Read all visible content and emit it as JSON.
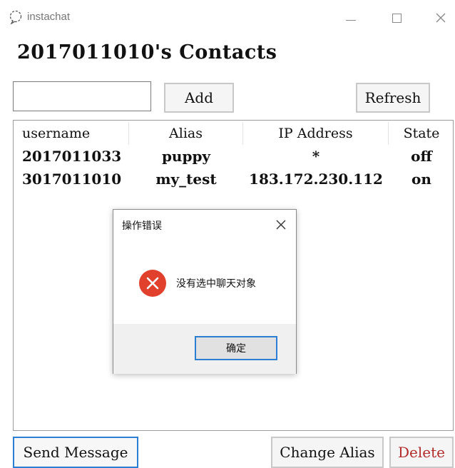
{
  "window": {
    "app_title": "instachat",
    "icons": {
      "app": "chat-bubble-icon",
      "minimize": "minimize-icon",
      "maximize": "maximize-icon",
      "close": "close-icon"
    }
  },
  "header": {
    "title": "2017011010's Contacts"
  },
  "toolbar": {
    "search_value": "",
    "add_label": "Add",
    "refresh_label": "Refresh"
  },
  "table": {
    "columns": [
      "username",
      "Alias",
      "IP Address",
      "State"
    ],
    "rows": [
      {
        "username": "2017011033",
        "alias": "puppy",
        "ip": "*",
        "state": "off"
      },
      {
        "username": "3017011010",
        "alias": "my_test",
        "ip": "183.172.230.112",
        "state": "on"
      }
    ]
  },
  "footer": {
    "send_label": "Send Message",
    "change_alias_label": "Change Alias",
    "delete_label": "Delete"
  },
  "dialog": {
    "title": "操作错误",
    "message": "没有选中聊天对象",
    "ok_label": "确定",
    "icon": "error-icon"
  },
  "colors": {
    "accent_blue": "#2a7fd4",
    "error_red": "#e1402d",
    "delete_red": "#b22b2b"
  }
}
